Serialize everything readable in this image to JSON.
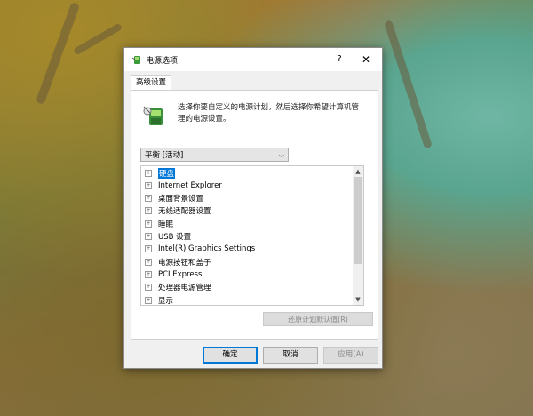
{
  "window": {
    "title": "电源选项",
    "title_icon": "power-options-icon",
    "help_label": "?",
    "close_label": "✕"
  },
  "tab": {
    "label": "高级设置"
  },
  "description": "选择你要自定义的电源计划，然后选择你希望计算机管理的电源设置。",
  "plan_select": {
    "value": "平衡 [活动]"
  },
  "tree_items": [
    {
      "label": "硬盘",
      "selected": true
    },
    {
      "label": "Internet Explorer"
    },
    {
      "label": "桌面背景设置"
    },
    {
      "label": "无线适配器设置"
    },
    {
      "label": "睡眠"
    },
    {
      "label": "USB 设置"
    },
    {
      "label": "Intel(R) Graphics Settings"
    },
    {
      "label": "电源按钮和盖子"
    },
    {
      "label": "PCI Express"
    },
    {
      "label": "处理器电源管理"
    },
    {
      "label": "显示"
    }
  ],
  "expander_symbol": "+",
  "restore_button": "还原计划默认值(R)",
  "buttons": {
    "ok": "确定",
    "cancel": "取消",
    "apply": "应用(A)"
  },
  "colors": {
    "selection": "#0078d7",
    "dialog_bg": "#f0f0f0"
  }
}
